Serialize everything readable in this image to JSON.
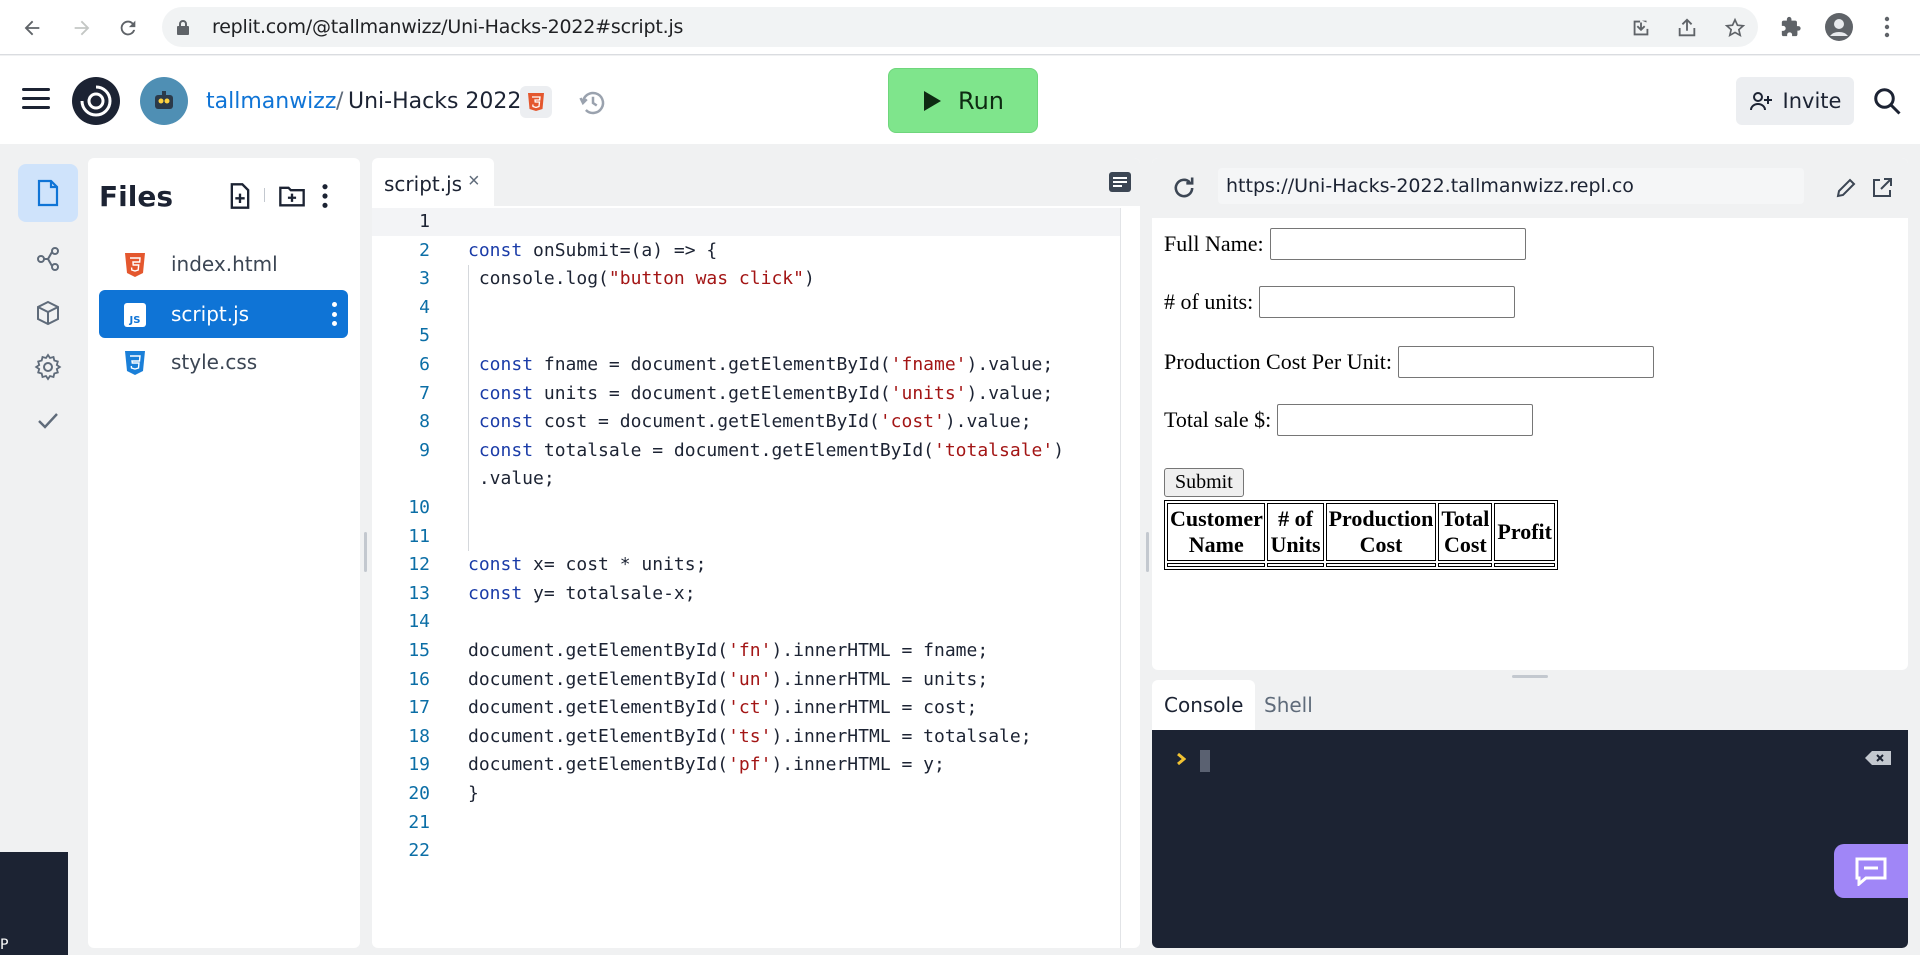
{
  "browser": {
    "url": "replit.com/@tallmanwizz/Uni-Hacks-2022#script.js"
  },
  "header": {
    "owner": "tallmanwizz",
    "separator": "/",
    "repl_name": "Uni-Hacks 2022",
    "run_label": "Run",
    "invite_label": "Invite"
  },
  "files": {
    "title": "Files",
    "items": [
      {
        "name": "index.html",
        "type": "html"
      },
      {
        "name": "script.js",
        "type": "js",
        "active": true
      },
      {
        "name": "style.css",
        "type": "css"
      }
    ]
  },
  "editor": {
    "tab_label": "script.js",
    "tab_close": "×",
    "line_numbers": [
      "1",
      "2",
      "3",
      "4",
      "5",
      "6",
      "7",
      "8",
      "9",
      "10",
      "11",
      "12",
      "13",
      "14",
      "15",
      "16",
      "17",
      "18",
      "19",
      "20",
      "21",
      "22"
    ],
    "lines": [
      "",
      "const onSubmit=(a) => {",
      " console.log(\"button was click\")",
      "",
      "",
      " const fname = document.getElementById('fname').value;",
      " const units = document.getElementById('units').value;",
      " const cost = document.getElementById('cost').value;",
      " const totalsale = document.getElementById('totalsale')",
      " .value;",
      "",
      "",
      "const x= cost * units;",
      "const y= totalsale-x;",
      "",
      "document.getElementById('fn').innerHTML = fname;",
      "document.getElementById('un').innerHTML = units;",
      "document.getElementById('ct').innerHTML = cost;",
      "document.getElementById('ts').innerHTML = totalsale;",
      "document.getElementById('pf').innerHTML = y;",
      "}",
      "",
      ""
    ]
  },
  "webview": {
    "url": "https://Uni-Hacks-2022.tallmanwizz.repl.co",
    "fields": [
      {
        "label": "Full Name:",
        "value": ""
      },
      {
        "label": "# of units:",
        "value": ""
      },
      {
        "label": "Production Cost Per Unit:",
        "value": ""
      },
      {
        "label": "Total sale $:",
        "value": ""
      }
    ],
    "submit_label": "Submit",
    "table_headers": [
      "Customer Name",
      "# of Units",
      "Production Cost",
      "Total Cost",
      "Profit"
    ]
  },
  "console": {
    "tabs": [
      "Console",
      "Shell"
    ],
    "active_tab": "Console"
  },
  "misc": {
    "corner_text": "P"
  },
  "colors": {
    "accent": "#0f74d6",
    "run_button": "#7fe58c",
    "console_bg": "#1c2333",
    "chat_fab": "#a086f7"
  }
}
